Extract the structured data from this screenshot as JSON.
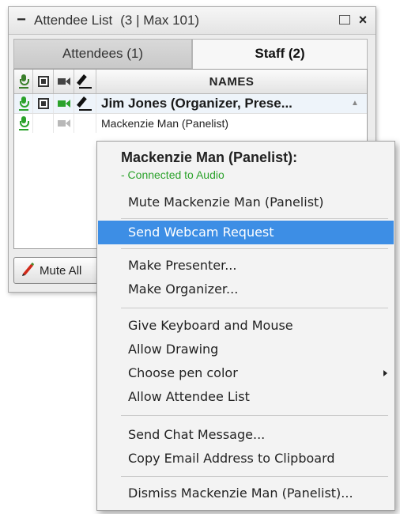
{
  "panel": {
    "title": "Attendee List",
    "count": "(3 | Max 101)",
    "tabs": [
      {
        "label": "Attendees (1)"
      },
      {
        "label": "Staff (2)"
      }
    ],
    "columns": {
      "names": "NAMES"
    },
    "rows": [
      {
        "name": "Jim Jones (Organizer, Prese..."
      },
      {
        "name": "Mackenzie Man (Panelist)"
      }
    ],
    "mute_all_label": "Mute All"
  },
  "menu": {
    "header_name": "Mackenzie Man (Panelist):",
    "header_status": "- Connected to Audio",
    "items": [
      "Mute Mackenzie Man (Panelist)",
      "Send Webcam Request",
      "Make Presenter...",
      "Make Organizer...",
      "Give Keyboard and Mouse",
      "Allow Drawing",
      "Choose pen color",
      "Allow Attendee List",
      "Send Chat Message...",
      "Copy Email Address to Clipboard",
      "Dismiss Mackenzie Man (Panelist)..."
    ]
  },
  "colors": {
    "highlight": "#3d8ee5",
    "audio_green": "#2ba22b",
    "pen_red": "#d02a1a"
  }
}
